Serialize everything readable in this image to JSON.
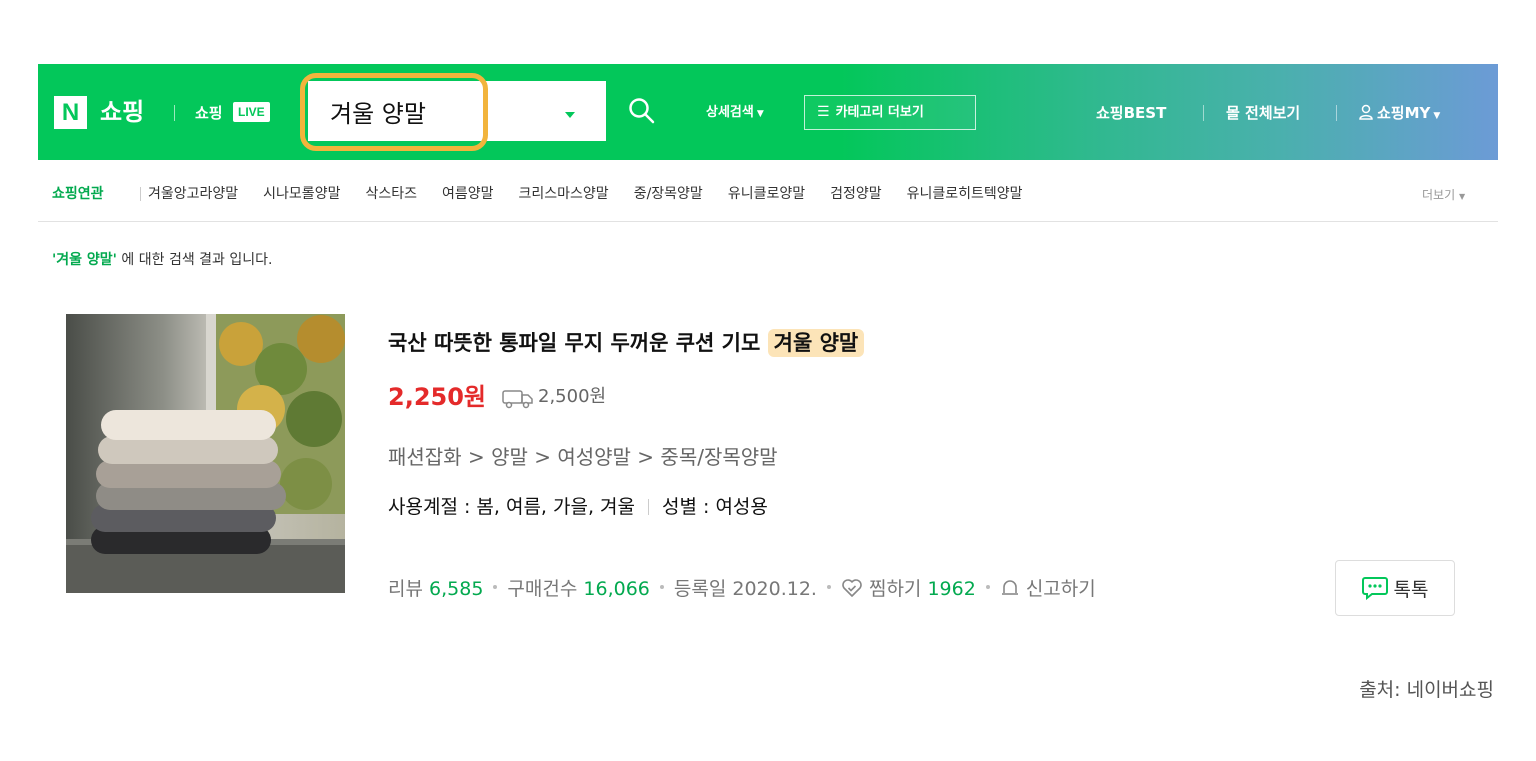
{
  "header": {
    "logo_letter": "N",
    "logo_text": "쇼핑",
    "live_text": "쇼핑",
    "live_badge": "LIVE",
    "search_query": "겨울 양말",
    "detail_search": "상세검색",
    "category_button": "카테고리 더보기",
    "shopping_best": "쇼핑BEST",
    "mall_all": "몰 전체보기",
    "my_shopping": "쇼핑MY",
    "colors": {
      "naver_green": "#03c75a",
      "highlight_ring": "#f2b43c"
    }
  },
  "related": {
    "title": "쇼핑연관",
    "keywords": [
      "겨울앙고라양말",
      "시나모롤양말",
      "삭스타즈",
      "여름양말",
      "크리스마스양말",
      "중/장목양말",
      "유니클로양말",
      "검정양말",
      "유니클로히트텍양말"
    ],
    "more": "더보기"
  },
  "result_note": {
    "query_quoted": "'겨울 양말'",
    "suffix": " 에 대한 검색 결과 입니다."
  },
  "product": {
    "title_prefix": "국산 따뜻한 통파일 무지 두꺼운 쿠션 기모 ",
    "title_highlight": "겨울 양말",
    "price": "2,250원",
    "shipping_fee": "2,500원",
    "category_path": "패션잡화 > 양말 > 여성양말 > 중목/장목양말",
    "season_attr": "사용계절 : 봄, 여름, 가을, 겨울",
    "gender_attr": "성별 : 여성용",
    "review_label": "리뷰",
    "review_count": "6,585",
    "purchase_label": "구매건수",
    "purchase_count": "16,066",
    "registered": "등록일 2020.12.",
    "wish_label": "찜하기",
    "wish_count": "1962",
    "report": "신고하기",
    "talk_button": "톡톡",
    "colors": {
      "price_red": "#e42a2a",
      "count_green": "#03a94f",
      "title_highlight_bg": "#fce4b8"
    }
  },
  "source_credit": "출처: 네이버쇼핑"
}
